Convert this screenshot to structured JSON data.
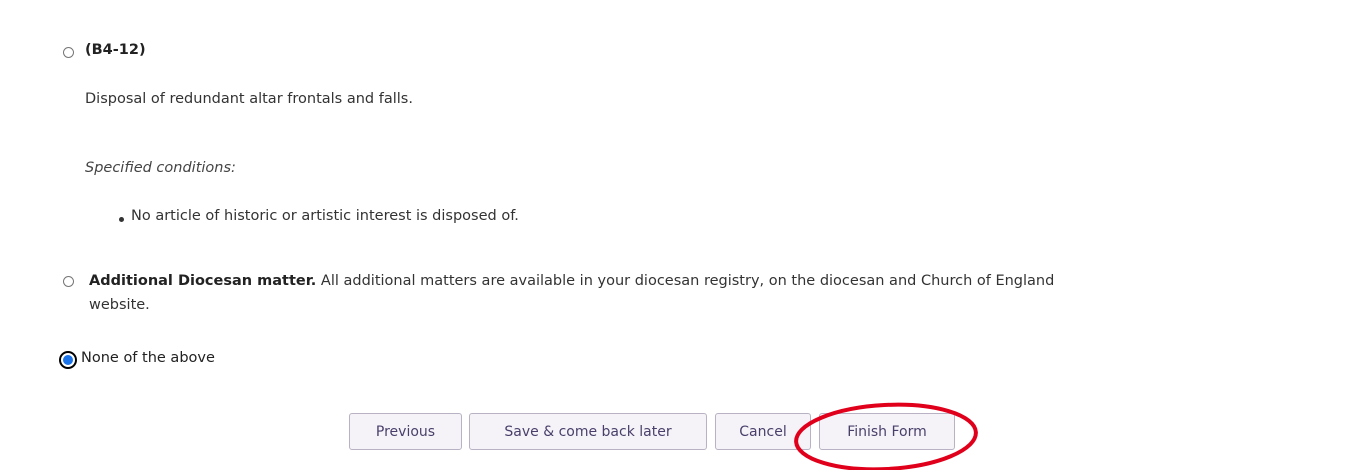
{
  "options": [
    {
      "code": "(B4-12)",
      "description": "Disposal of redundant altar frontals and falls.",
      "conditions_heading": "Specified conditions:",
      "conditions": [
        "No article of historic or artistic interest is disposed of."
      ],
      "selected": false
    },
    {
      "title": "Additional Diocesan matter.",
      "text_line1": "All additional matters are available in your diocesan registry, on the diocesan and Church of England",
      "text_line2": "website.",
      "selected": false
    },
    {
      "title": "None of the above",
      "selected": true
    }
  ],
  "buttons": {
    "previous": "Previous",
    "save": "Save & come back later",
    "cancel": "Cancel",
    "finish": "Finish Form"
  },
  "colors": {
    "radio_selected": "#1a73e8",
    "button_text": "#4a3f6b",
    "annotation_circle": "#e0001b"
  }
}
